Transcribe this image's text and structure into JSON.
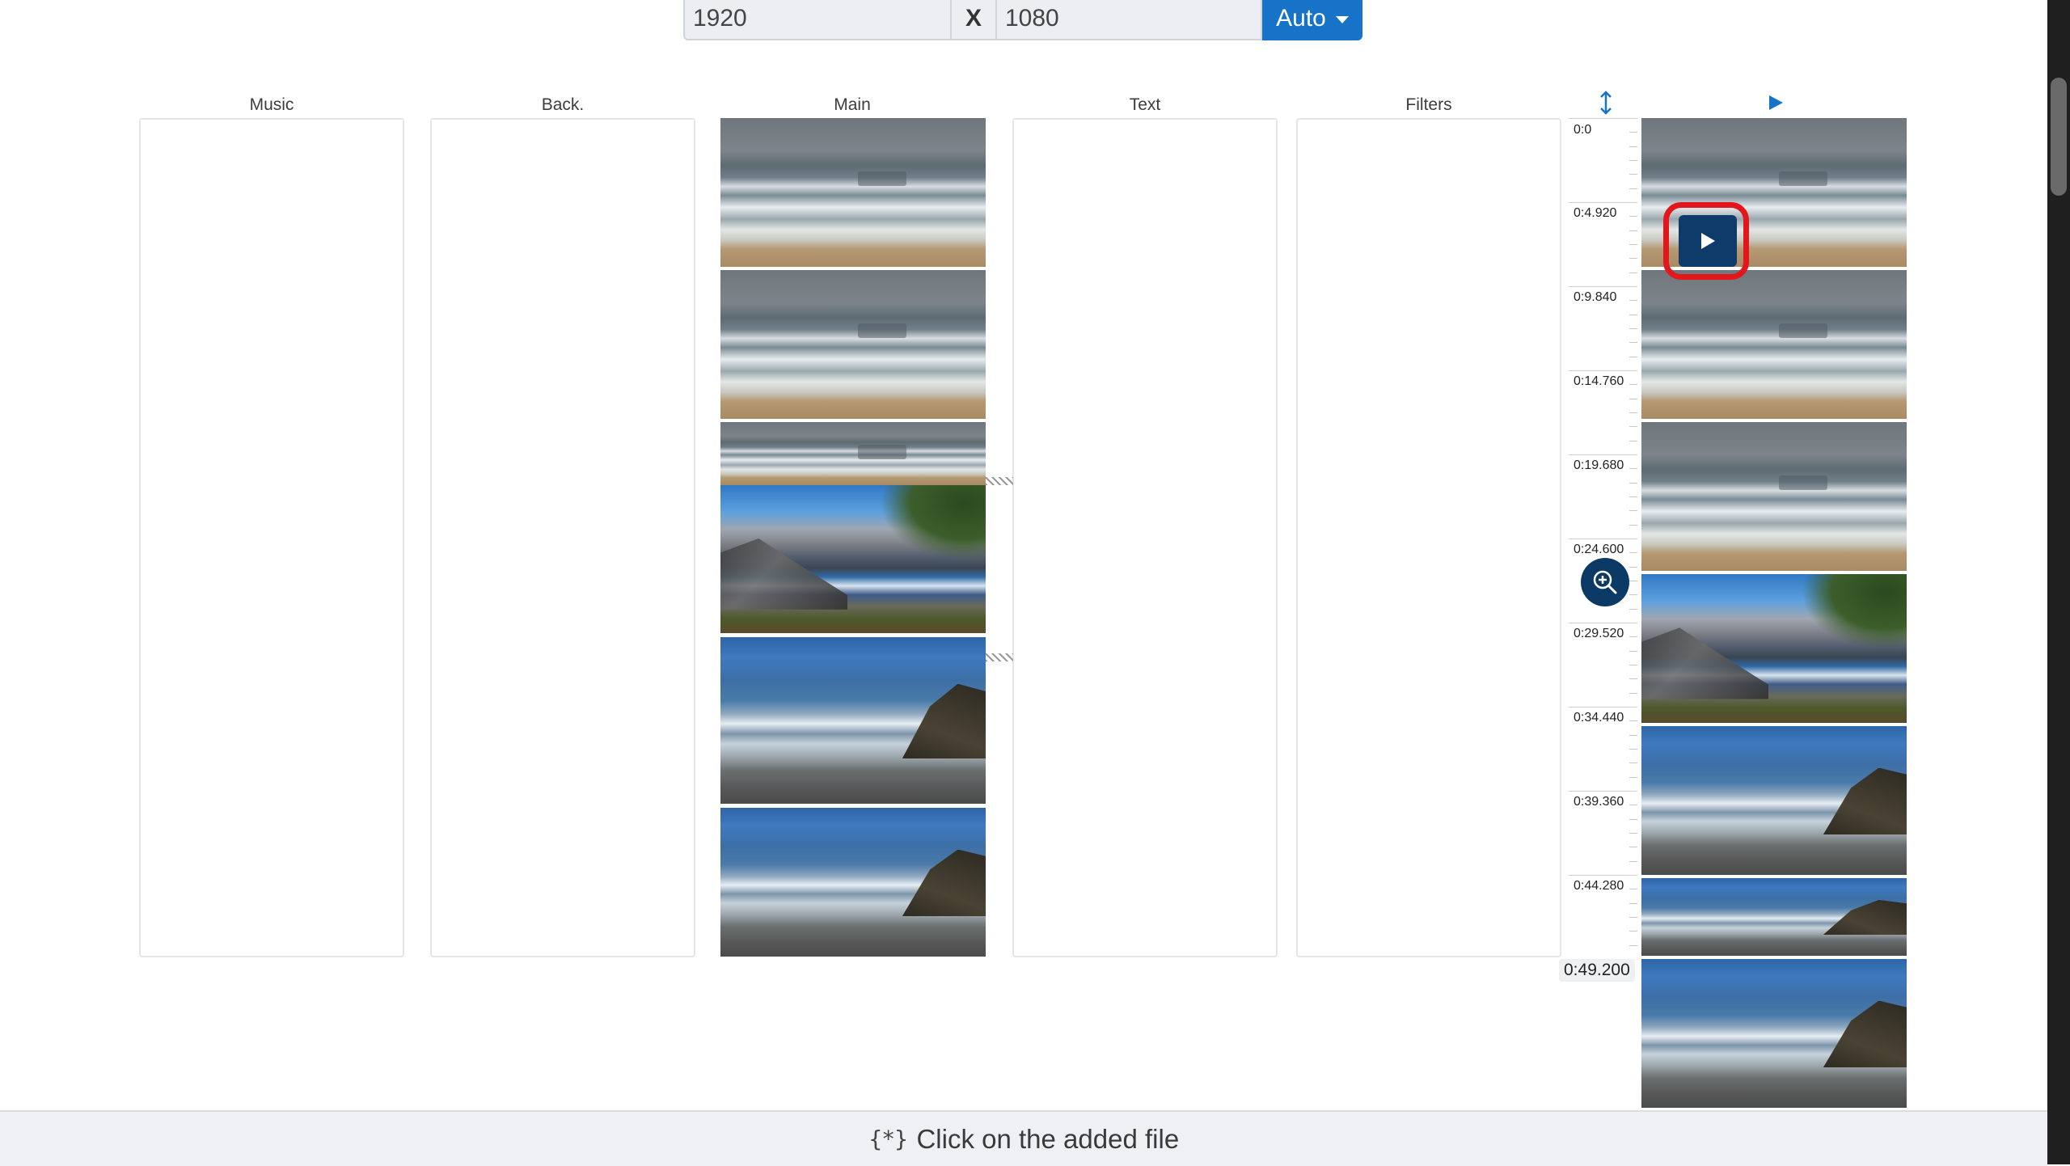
{
  "resolution": {
    "width": "1920",
    "separator": "X",
    "height": "1080",
    "preset_label": "Auto"
  },
  "tracks": {
    "music": "Music",
    "background": "Back.",
    "main": "Main",
    "text": "Text",
    "filters": "Filters"
  },
  "ruler": {
    "labels": [
      "0:0",
      "0:4.920",
      "0:9.840",
      "0:14.760",
      "0:19.680",
      "0:24.600",
      "0:29.520",
      "0:34.440",
      "0:39.360",
      "0:44.280"
    ],
    "total": "0:49.200"
  },
  "icons": {
    "resize": "up-down-arrow-icon",
    "preview": "play-icon",
    "zoom": "zoom-in-icon",
    "status": "sparkle-icon"
  },
  "status": {
    "icon_glyph": "{*}",
    "message": "Click on the added file"
  },
  "colors": {
    "accent": "#1673c7",
    "dark_button": "#0f3b6b",
    "highlight": "#e3161b"
  }
}
